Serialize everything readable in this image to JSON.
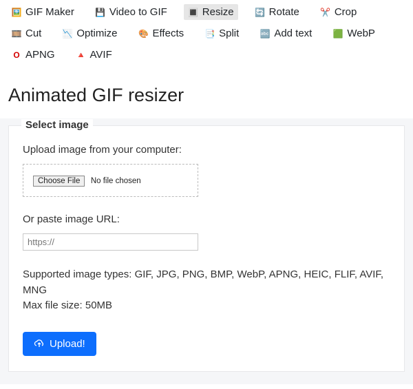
{
  "toolbar": {
    "items": [
      {
        "label": "GIF Maker",
        "icon": "🖼️",
        "name": "tool-gif-maker",
        "active": false
      },
      {
        "label": "Video to GIF",
        "icon": "💾",
        "name": "tool-video-to-gif",
        "active": false
      },
      {
        "label": "Resize",
        "icon": "🔳",
        "name": "tool-resize",
        "active": true
      },
      {
        "label": "Rotate",
        "icon": "🔄",
        "name": "tool-rotate",
        "active": false
      },
      {
        "label": "Crop",
        "icon": "✂️",
        "name": "tool-crop",
        "active": false
      },
      {
        "label": "Cut",
        "icon": "🎞️",
        "name": "tool-cut",
        "active": false
      },
      {
        "label": "Optimize",
        "icon": "📉",
        "name": "tool-optimize",
        "active": false
      },
      {
        "label": "Effects",
        "icon": "🎨",
        "name": "tool-effects",
        "active": false
      },
      {
        "label": "Split",
        "icon": "📑",
        "name": "tool-split",
        "active": false
      },
      {
        "label": "Add text",
        "icon": "🔤",
        "name": "tool-add-text",
        "active": false
      },
      {
        "label": "WebP",
        "icon": "🟩",
        "name": "tool-webp",
        "active": false
      },
      {
        "label": "APNG",
        "icon": "⭕",
        "name": "tool-apng",
        "active": false,
        "icon_html": "<span style='color:#d40000;font-weight:bold;'>O</span>"
      },
      {
        "label": "AVIF",
        "icon": "🔺",
        "name": "tool-avif",
        "active": false
      }
    ]
  },
  "page": {
    "title": "Animated GIF resizer"
  },
  "form": {
    "legend": "Select image",
    "upload_label": "Upload image from your computer:",
    "choose_file_button": "Choose File",
    "no_file_text": "No file chosen",
    "url_label": "Or paste image URL:",
    "url_placeholder": "https://",
    "supported_text": "Supported image types: GIF, JPG, PNG, BMP, WebP, APNG, HEIC, FLIF, AVIF, MNG",
    "max_size_text": "Max file size: 50MB",
    "submit_label": "Upload!"
  }
}
